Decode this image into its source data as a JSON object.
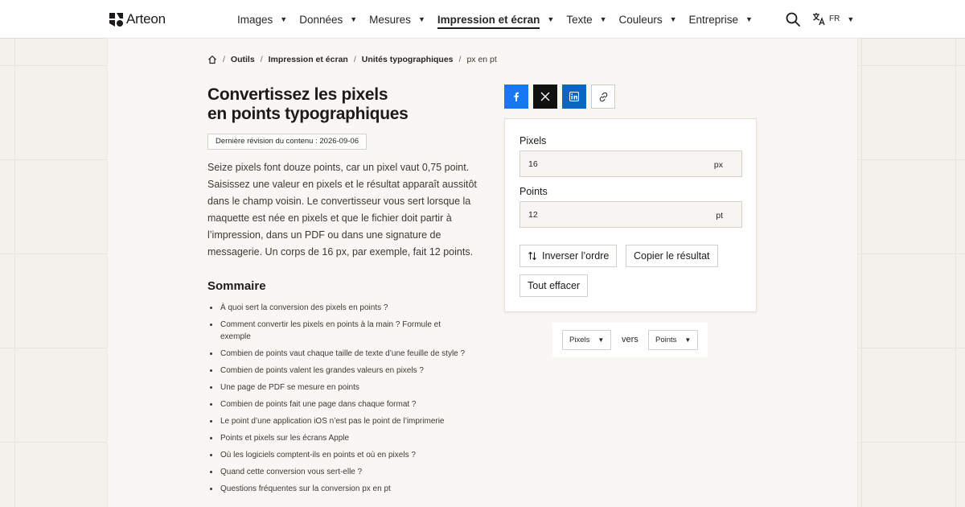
{
  "header": {
    "logo_text": "Arteon",
    "nav": [
      {
        "label": "Images",
        "active": false
      },
      {
        "label": "Données",
        "active": false
      },
      {
        "label": "Mesures",
        "active": false
      },
      {
        "label": "Impression et écran",
        "active": true
      },
      {
        "label": "Texte",
        "active": false
      },
      {
        "label": "Couleurs",
        "active": false
      },
      {
        "label": "Entreprise",
        "active": false
      }
    ],
    "caret": "▼",
    "language": "FR"
  },
  "breadcrumb": {
    "items": [
      "Outils",
      "Impression et écran",
      "Unités typographiques"
    ],
    "current": "px en pt",
    "separator": "/"
  },
  "article": {
    "title_line1": "Convertissez les pixels",
    "title_line2": "en points typographiques",
    "revision": "Dernière révision du contenu : 2026-09-06",
    "intro": "Seize pixels font douze points, car un pixel vaut 0,75 point. Saisissez une valeur en pixels et le résultat apparaît aussitôt dans le champ voisin. Le convertisseur vous sert lorsque la maquette est née en pixels et que le fichier doit partir à l’impression, dans un PDF ou dans une signature de messagerie. Un corps de 16 px, par exemple, fait 12 points.",
    "toc_title": "Sommaire",
    "toc": [
      "À quoi sert la conversion des pixels en points ?",
      "Comment convertir les pixels en points à la main ? Formule et exemple",
      "Combien de points vaut chaque taille de texte d’une feuille de style ?",
      "Combien de points valent les grandes valeurs en pixels ?",
      "Une page de PDF se mesure en points",
      "Combien de points fait une page dans chaque format ?",
      "Le point d’une application iOS n’est pas le point de l’imprimerie",
      "Points et pixels sur les écrans Apple",
      "Où les logiciels comptent-ils en points et où en pixels ?",
      "Quand cette conversion vous sert-elle ?",
      "Questions fréquentes sur la conversion px en pt"
    ]
  },
  "converter": {
    "pixels_label": "Pixels",
    "pixels_value": "16",
    "pixels_unit": "px",
    "points_label": "Points",
    "points_value": "12",
    "points_unit": "pt",
    "swap_label": "Inverser l’ordre",
    "copy_label": "Copier le résultat",
    "clear_label": "Tout effacer"
  },
  "unit_selector": {
    "from": "Pixels",
    "connector": "vers",
    "to": "Points"
  },
  "colors": {
    "facebook": "#1877f2",
    "x": "#111111",
    "linkedin": "#0a66c2"
  }
}
